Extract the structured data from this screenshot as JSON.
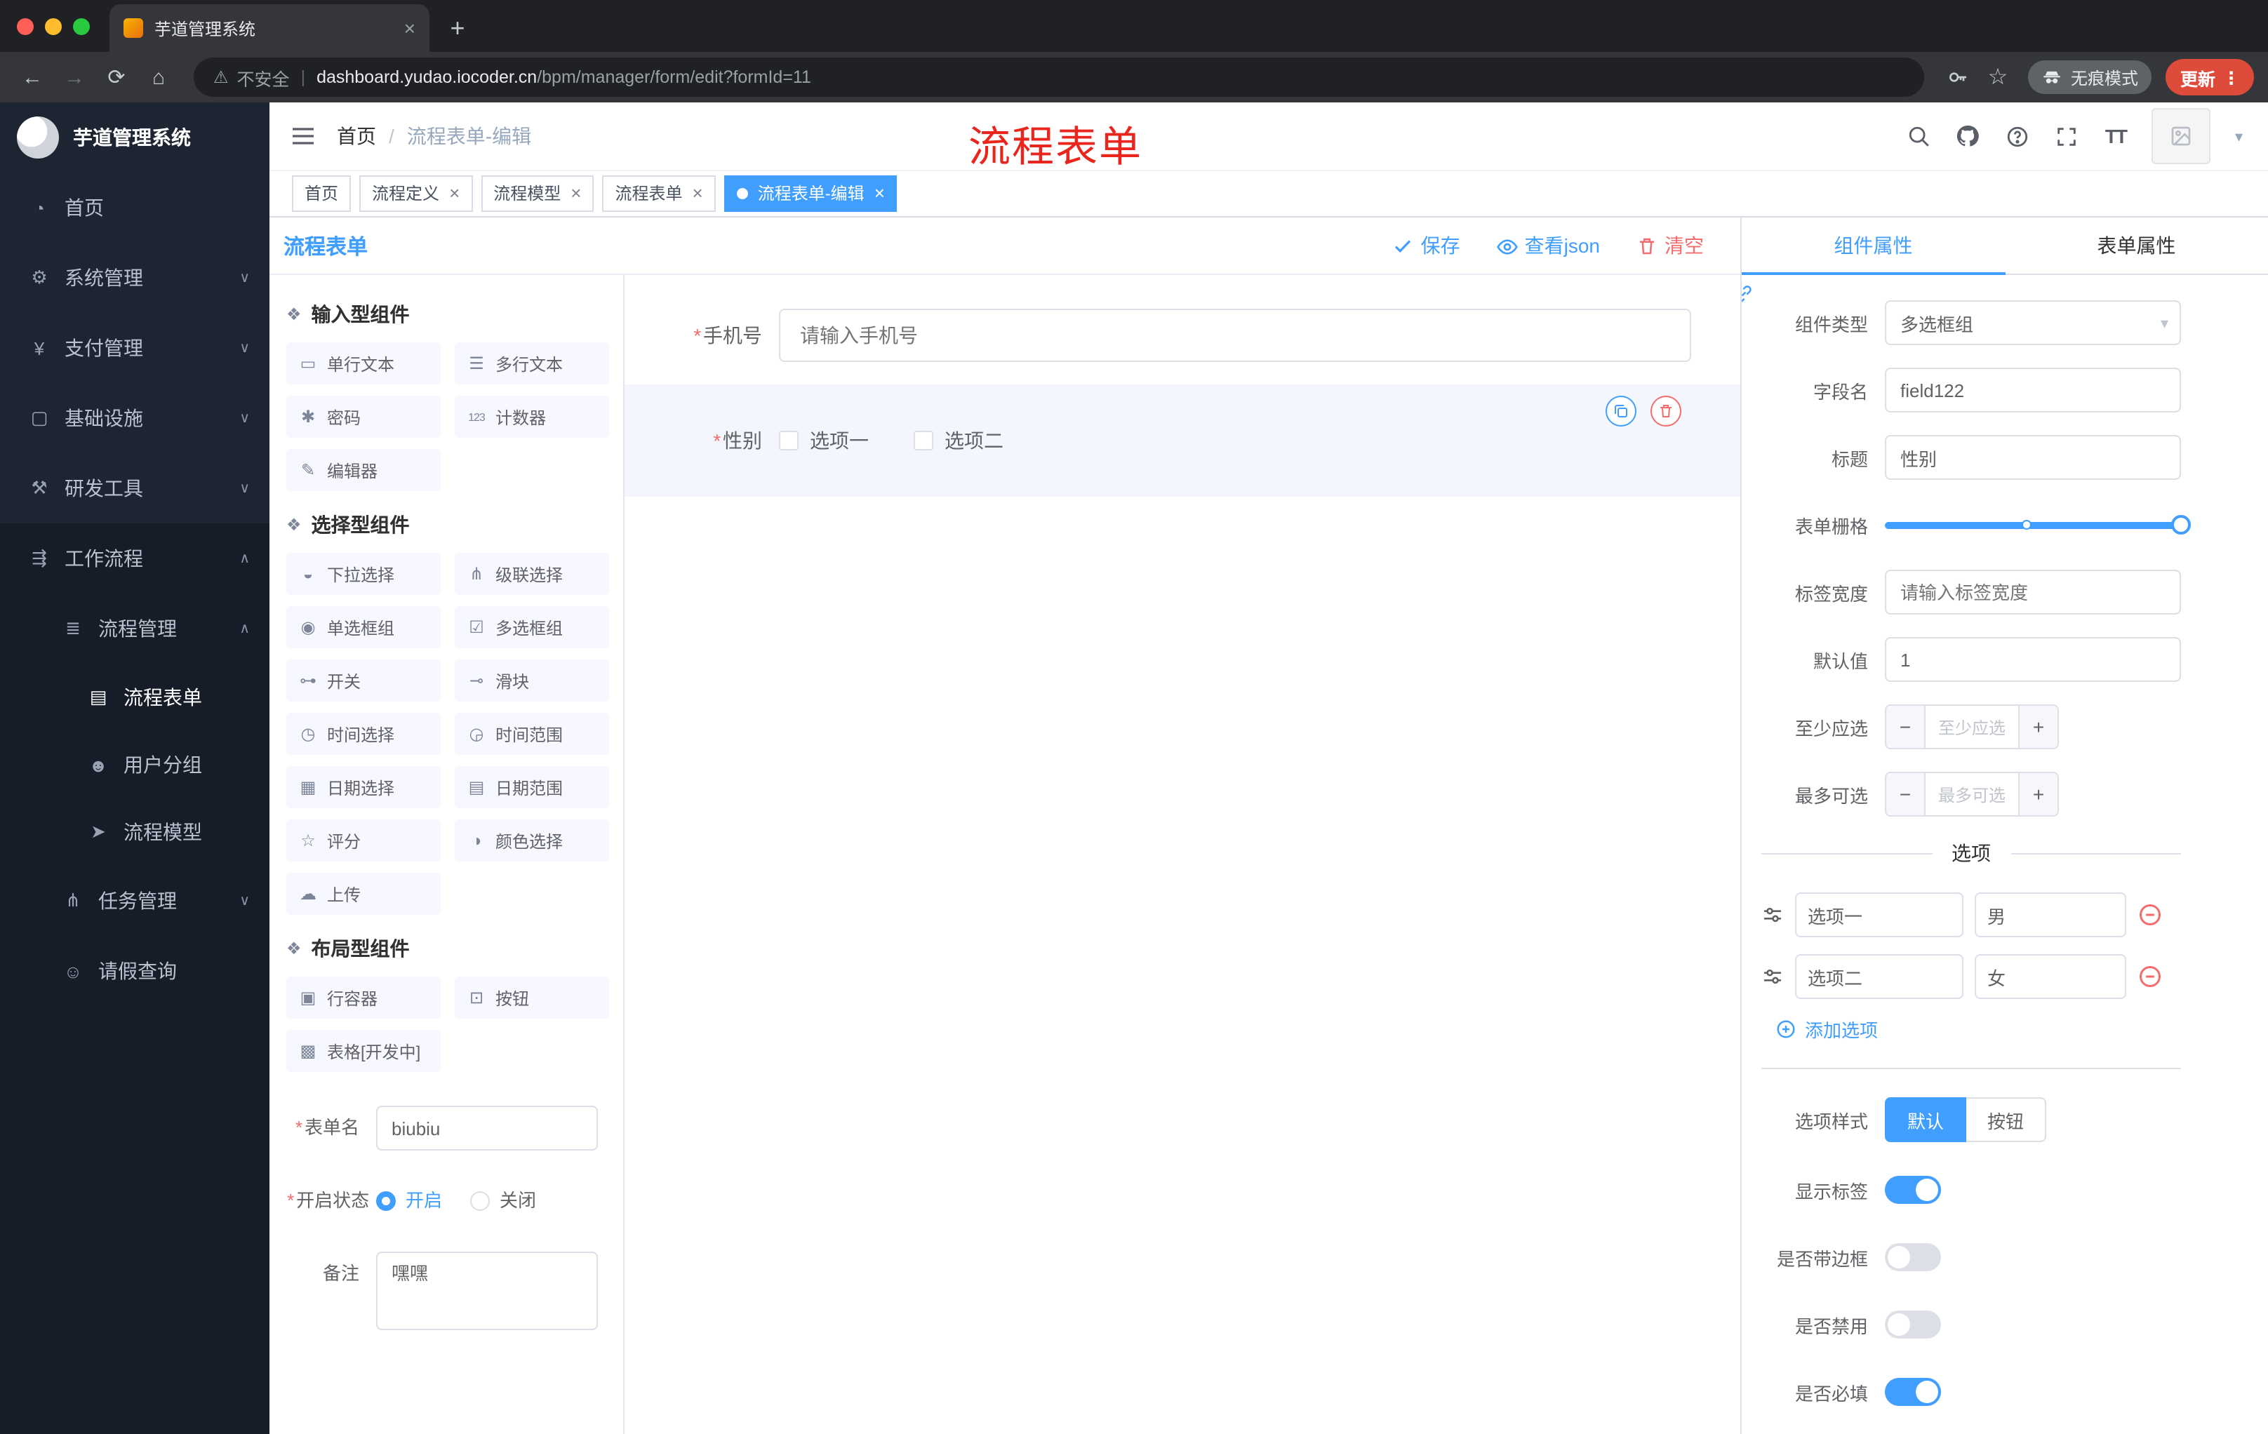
{
  "colors": {
    "accent": "#409EFF",
    "danger": "#F56C6C",
    "annotation": "#E8261D",
    "sidebar_bg": "#161C28",
    "chip_bg": "#F6F7FF",
    "selected_row_bg": "#F4F6FE",
    "update_pill": "#DE4B3B"
  },
  "misc": {
    "required_mark": "*",
    "breadcrumb_separator": "/"
  },
  "icons": {
    "chevron_down": "∨",
    "chevron_up": "∧",
    "caret_down": "▾",
    "close": "×",
    "plus": "+",
    "back": "←",
    "forward": "→",
    "reload": "⟳",
    "home": "⌂",
    "warning": "⚠",
    "star": "☆",
    "dots": "⋮",
    "minus": "−",
    "font_size": "TT"
  },
  "browser": {
    "tab_title": "芋道管理系统",
    "security_label": "不安全",
    "url_host": "dashboard.yudao.iocoder.cn",
    "url_path": "/bpm/manager/form/edit?formId=11",
    "incognito_label": "无痕模式",
    "update_label": "更新"
  },
  "sidebar": {
    "logo_title": "芋道管理系统",
    "items": [
      {
        "label": "首页",
        "icon": "◔"
      },
      {
        "label": "系统管理",
        "icon": "⚙"
      },
      {
        "label": "支付管理",
        "icon": "¥"
      },
      {
        "label": "基础设施",
        "icon": "▢"
      },
      {
        "label": "研发工具",
        "icon": "⚒"
      },
      {
        "label": "工作流程",
        "icon": "⇶"
      }
    ],
    "process_mgmt": {
      "label": "流程管理",
      "icon": "≣"
    },
    "process_children": [
      {
        "label": "流程表单",
        "icon": "▤"
      },
      {
        "label": "用户分组",
        "icon": "☻"
      },
      {
        "label": "流程模型",
        "icon": "➤"
      }
    ],
    "task_mgmt": {
      "label": "任务管理",
      "icon": "⋔"
    },
    "leave_query": {
      "label": "请假查询",
      "icon": "☺"
    }
  },
  "header": {
    "breadcrumb_home": "首页",
    "breadcrumb_current": "流程表单-编辑",
    "annotation": "流程表单"
  },
  "tags": [
    {
      "label": "首页"
    },
    {
      "label": "流程定义"
    },
    {
      "label": "流程模型"
    },
    {
      "label": "流程表单"
    },
    {
      "label": "流程表单-编辑"
    }
  ],
  "designer": {
    "title": "流程表单",
    "save": "保存",
    "view_json": "查看json",
    "clear": "清空"
  },
  "palette": {
    "sections": [
      {
        "title": "输入型组件",
        "items": [
          {
            "label": "单行文本",
            "icon": "▭"
          },
          {
            "label": "多行文本",
            "icon": "☰"
          },
          {
            "label": "密码",
            "icon": "✱"
          },
          {
            "label": "计数器",
            "icon": "123"
          },
          {
            "label": "编辑器",
            "icon": "✎"
          }
        ]
      },
      {
        "title": "选择型组件",
        "items": [
          {
            "label": "下拉选择",
            "icon": "◒"
          },
          {
            "label": "级联选择",
            "icon": "⋔"
          },
          {
            "label": "单选框组",
            "icon": "◉"
          },
          {
            "label": "多选框组",
            "icon": "☑"
          },
          {
            "label": "开关",
            "icon": "⊶"
          },
          {
            "label": "滑块",
            "icon": "⊸"
          },
          {
            "label": "时间选择",
            "icon": "◷"
          },
          {
            "label": "时间范围",
            "icon": "◶"
          },
          {
            "label": "日期选择",
            "icon": "▦"
          },
          {
            "label": "日期范围",
            "icon": "▤"
          },
          {
            "label": "评分",
            "icon": "☆"
          },
          {
            "label": "颜色选择",
            "icon": "◑"
          },
          {
            "label": "上传",
            "icon": "☁"
          }
        ]
      },
      {
        "title": "布局型组件",
        "items": [
          {
            "label": "行容器",
            "icon": "▣"
          },
          {
            "label": "按钮",
            "icon": "⊡"
          },
          {
            "label": "表格[开发中]",
            "icon": "▩"
          }
        ]
      }
    ],
    "form": {
      "name_label": "表单名",
      "name_value": "biubiu",
      "status_label": "开启状态",
      "status_on": "开启",
      "status_off": "关闭",
      "remark_label": "备注",
      "remark_value": "嘿嘿"
    }
  },
  "canvas": {
    "phone": {
      "label": "手机号",
      "placeholder": "请输入手机号"
    },
    "gender": {
      "label": "性别",
      "opt1": "选项一",
      "opt2": "选项二"
    }
  },
  "props": {
    "tab_component": "组件属性",
    "tab_form": "表单属性",
    "component_type_label": "组件类型",
    "component_type_value": "多选框组",
    "field_label": "字段名",
    "field_value": "field122",
    "title_label": "标题",
    "title_value": "性别",
    "grid_label": "表单栅格",
    "label_width_label": "标签宽度",
    "label_width_placeholder": "请输入标签宽度",
    "default_label": "默认值",
    "default_value": "1",
    "min_label": "至少应选",
    "min_placeholder": "至少应选",
    "max_label": "最多可选",
    "max_placeholder": "最多可选",
    "options_divider": "选项",
    "opt1_label": "选项一",
    "opt1_value": "男",
    "opt2_label": "选项二",
    "opt2_value": "女",
    "add_option": "添加选项",
    "style_label": "选项样式",
    "style_default": "默认",
    "style_button": "按钮",
    "show_label": "显示标签",
    "border_label": "是否带边框",
    "disabled_label": "是否禁用",
    "required_label": "是否必填"
  }
}
